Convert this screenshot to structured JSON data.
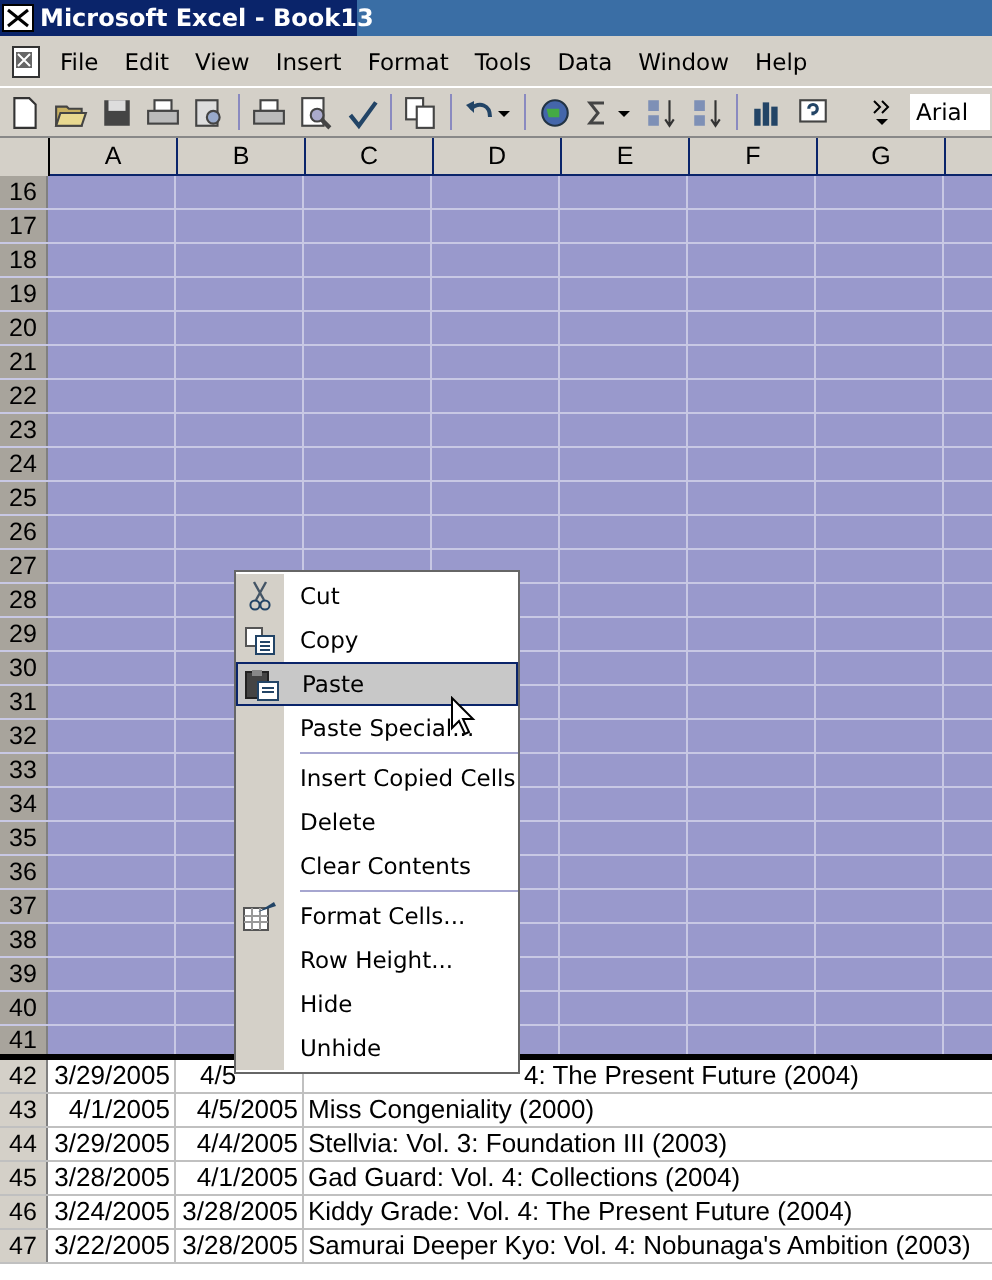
{
  "window": {
    "title": "Microsoft Excel - Book13"
  },
  "menu_bar": [
    "File",
    "Edit",
    "View",
    "Insert",
    "Format",
    "Tools",
    "Data",
    "Window",
    "Help"
  ],
  "font_field": {
    "value": "Arial"
  },
  "columns": [
    "A",
    "B",
    "C",
    "D",
    "E",
    "F",
    "G"
  ],
  "rows": [
    {
      "number": "16",
      "selected": true
    },
    {
      "number": "17",
      "selected": true
    },
    {
      "number": "18",
      "selected": true
    },
    {
      "number": "19",
      "selected": true
    },
    {
      "number": "20",
      "selected": true
    },
    {
      "number": "21",
      "selected": true
    },
    {
      "number": "22",
      "selected": true
    },
    {
      "number": "23",
      "selected": true
    },
    {
      "number": "24",
      "selected": true
    },
    {
      "number": "25",
      "selected": true
    },
    {
      "number": "26",
      "selected": true
    },
    {
      "number": "27",
      "selected": true
    },
    {
      "number": "28",
      "selected": true
    },
    {
      "number": "29",
      "selected": true
    },
    {
      "number": "30",
      "selected": true
    },
    {
      "number": "31",
      "selected": true
    },
    {
      "number": "32",
      "selected": true
    },
    {
      "number": "33",
      "selected": true
    },
    {
      "number": "34",
      "selected": true
    },
    {
      "number": "35",
      "selected": true
    },
    {
      "number": "36",
      "selected": true
    },
    {
      "number": "37",
      "selected": true
    },
    {
      "number": "38",
      "selected": true
    },
    {
      "number": "39",
      "selected": true
    },
    {
      "number": "40",
      "selected": true
    },
    {
      "number": "41",
      "selected": true
    },
    {
      "number": "42",
      "selected": false,
      "cells": [
        "3/29/2005",
        "4/5",
        "4: The Present Future (2004)"
      ]
    },
    {
      "number": "43",
      "selected": false,
      "cells": [
        "4/1/2005",
        "4/5/2005",
        "Miss Congeniality (2000)"
      ]
    },
    {
      "number": "44",
      "selected": false,
      "cells": [
        "3/29/2005",
        "4/4/2005",
        "Stellvia: Vol. 3: Foundation III (2003)"
      ]
    },
    {
      "number": "45",
      "selected": false,
      "cells": [
        "3/28/2005",
        "4/1/2005",
        "Gad Guard: Vol. 4: Collections (2004)"
      ]
    },
    {
      "number": "46",
      "selected": false,
      "cells": [
        "3/24/2005",
        "3/28/2005",
        "Kiddy Grade: Vol. 4: The Present Future (2004)"
      ]
    },
    {
      "number": "47",
      "selected": false,
      "cells": [
        "3/22/2005",
        "3/28/2005",
        "Samurai Deeper Kyo: Vol. 4: Nobunaga's Ambition (2003)"
      ]
    }
  ],
  "context_menu": [
    {
      "kind": "item",
      "label": "Cut",
      "selected": false
    },
    {
      "kind": "item",
      "label": "Copy",
      "selected": false
    },
    {
      "kind": "item",
      "label": "Paste",
      "selected": true
    },
    {
      "kind": "item",
      "label": "Paste Special...",
      "selected": false
    },
    {
      "kind": "separator"
    },
    {
      "kind": "item",
      "label": "Insert Copied Cells",
      "selected": false
    },
    {
      "kind": "item",
      "label": "Delete",
      "selected": false
    },
    {
      "kind": "item",
      "label": "Clear Contents",
      "selected": false
    },
    {
      "kind": "separator"
    },
    {
      "kind": "item",
      "label": "Format Cells...",
      "selected": false
    },
    {
      "kind": "item",
      "label": "Row Height...",
      "selected": false
    },
    {
      "kind": "item",
      "label": "Hide",
      "selected": false
    },
    {
      "kind": "item",
      "label": "Unhide",
      "selected": false
    }
  ]
}
